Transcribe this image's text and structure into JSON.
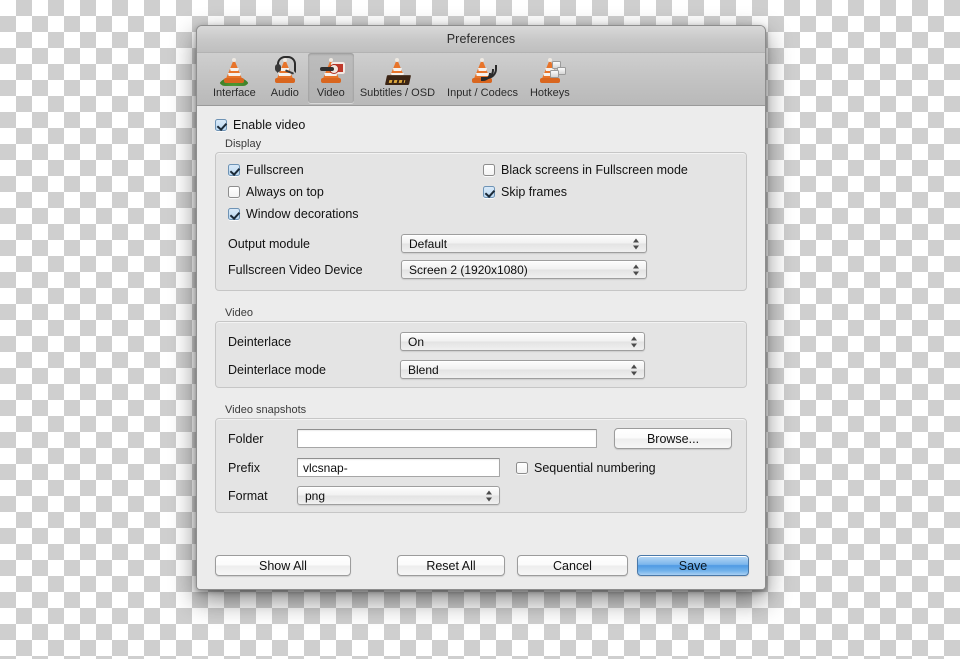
{
  "window": {
    "title": "Preferences"
  },
  "toolbar": {
    "tabs": [
      {
        "label": "Interface",
        "icon": "vlc-cone-interface-icon",
        "selected": false
      },
      {
        "label": "Audio",
        "icon": "vlc-cone-audio-icon",
        "selected": false
      },
      {
        "label": "Video",
        "icon": "vlc-cone-video-icon",
        "selected": true
      },
      {
        "label": "Subtitles / OSD",
        "icon": "vlc-cone-subtitles-icon",
        "selected": false
      },
      {
        "label": "Input / Codecs",
        "icon": "vlc-cone-input-icon",
        "selected": false
      },
      {
        "label": "Hotkeys",
        "icon": "vlc-cone-hotkeys-icon",
        "selected": false
      }
    ]
  },
  "enable_video": {
    "label": "Enable video",
    "checked": true
  },
  "display": {
    "group_title": "Display",
    "fullscreen": {
      "label": "Fullscreen",
      "checked": true
    },
    "always_on_top": {
      "label": "Always on top",
      "checked": false
    },
    "window_decorations": {
      "label": "Window decorations",
      "checked": true
    },
    "black_screens": {
      "label": "Black screens in Fullscreen mode",
      "checked": false
    },
    "skip_frames": {
      "label": "Skip frames",
      "checked": true
    },
    "output_module": {
      "label": "Output module",
      "value": "Default"
    },
    "fullscreen_video_device": {
      "label": "Fullscreen Video Device",
      "value": "Screen 2 (1920x1080)"
    }
  },
  "video": {
    "group_title": "Video",
    "deinterlace": {
      "label": "Deinterlace",
      "value": "On"
    },
    "deinterlace_mode": {
      "label": "Deinterlace mode",
      "value": "Blend"
    }
  },
  "snapshots": {
    "group_title": "Video snapshots",
    "folder": {
      "label": "Folder",
      "value": "",
      "placeholder": ""
    },
    "browse": {
      "label": "Browse..."
    },
    "prefix": {
      "label": "Prefix",
      "value": "vlcsnap-",
      "placeholder": ""
    },
    "sequential": {
      "label": "Sequential numbering",
      "checked": false
    },
    "format": {
      "label": "Format",
      "value": "png"
    }
  },
  "footer": {
    "show_all": "Show All",
    "reset_all": "Reset All",
    "cancel": "Cancel",
    "save": "Save"
  },
  "colors": {
    "accent_default_button": "#4f9ae4",
    "window_background": "#ececec",
    "group_background": "#e4e4e4",
    "checkbox_checked": "#bcd9f2"
  }
}
